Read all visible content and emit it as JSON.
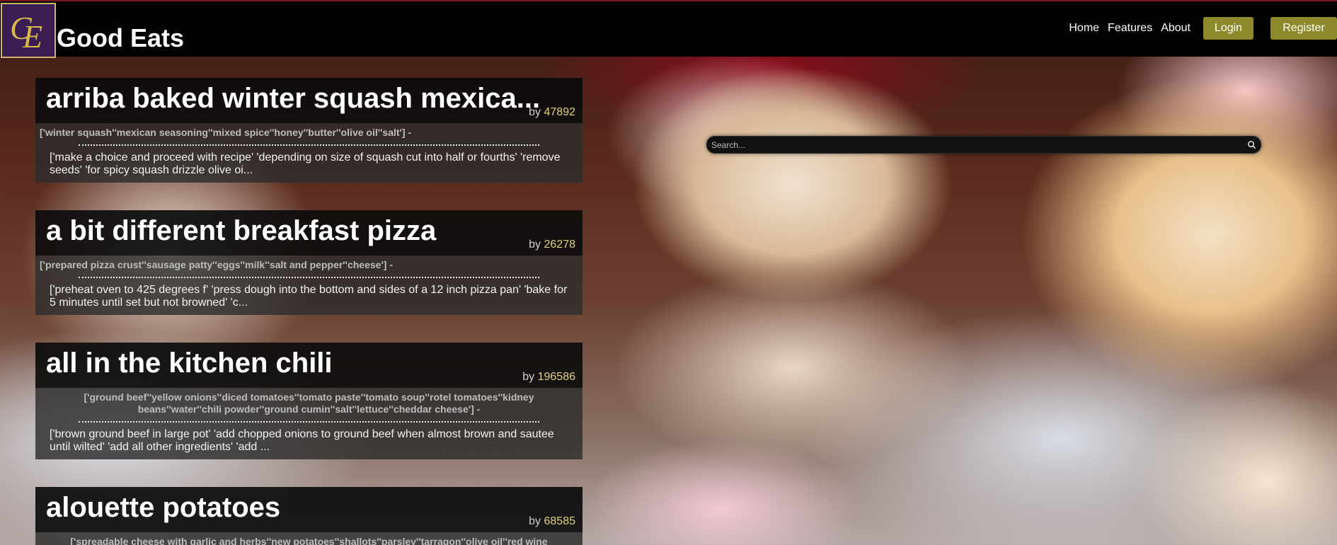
{
  "app": {
    "brand": "Good Eats",
    "logo_text": "GE"
  },
  "nav": {
    "home": "Home",
    "features": "Features",
    "about": "About",
    "login": "Login",
    "register": "Register"
  },
  "search": {
    "placeholder": "Search...",
    "icon": "search-icon"
  },
  "recipes": [
    {
      "title": "arriba baked winter squash mexica...",
      "by_label": "by",
      "author_id": "47892",
      "ingredients": "['winter squash''mexican seasoning''mixed spice''honey''butter''olive oil''salt'] -",
      "steps": "['make a choice and proceed with recipe' 'depending on size of squash cut into half or fourths' 'remove seeds' 'for spicy squash drizzle olive oi..."
    },
    {
      "title": "a bit different breakfast pizza",
      "by_label": "by",
      "author_id": "26278",
      "ingredients": "['prepared pizza crust''sausage patty''eggs''milk''salt and pepper''cheese'] -",
      "steps": "['preheat oven to 425 degrees f' 'press dough into the bottom and sides of a 12 inch pizza pan' 'bake for 5 minutes until set but not browned' 'c..."
    },
    {
      "title": "all in the kitchen chili",
      "by_label": "by",
      "author_id": "196586",
      "ingredients": "['ground beef''yellow onions''diced tomatoes''tomato paste''tomato soup''rotel tomatoes''kidney beans''water''chili powder''ground cumin''salt''lettuce''cheddar cheese'] -",
      "steps": "['brown ground beef in large pot' 'add chopped onions to ground beef when almost brown and sautee until wilted' 'add all other ingredients' 'add ..."
    },
    {
      "title": "alouette potatoes",
      "by_label": "by",
      "author_id": "68585",
      "ingredients": "['spreadable cheese with garlic and herbs''new potatoes''shallots''parsley''tarragon''olive oil''red wine",
      "steps": ""
    }
  ]
}
